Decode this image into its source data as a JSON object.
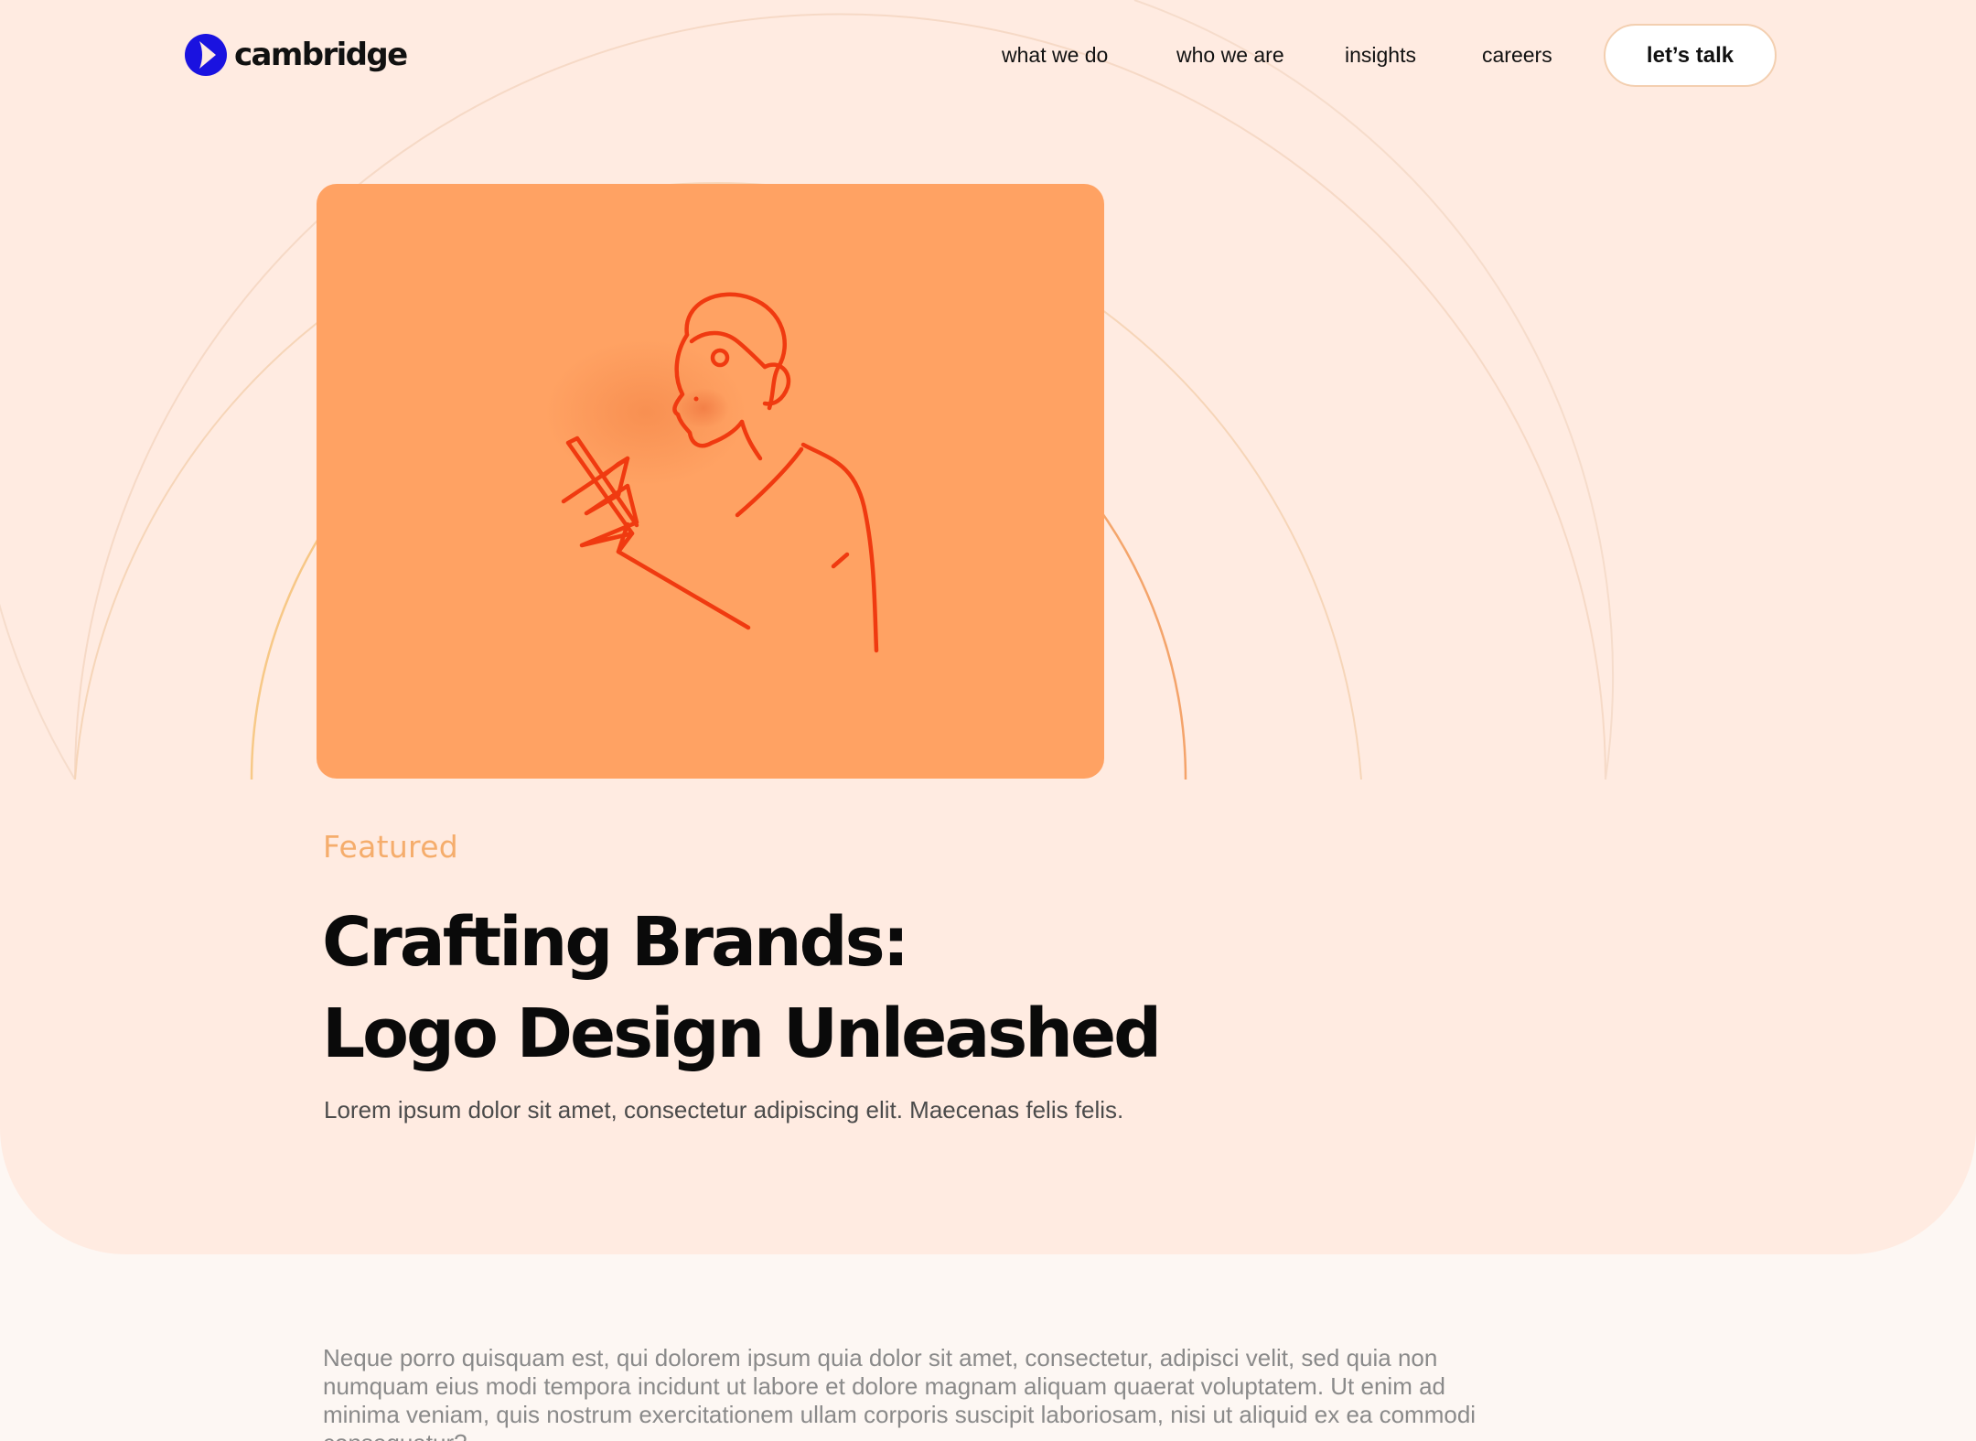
{
  "brand": {
    "name": "cambridge",
    "logo_color": "#1a12e0"
  },
  "nav": {
    "items": [
      {
        "label": "what we do"
      },
      {
        "label": "who we are"
      },
      {
        "label": "insights"
      },
      {
        "label": "careers"
      }
    ],
    "cta_label": "let’s talk"
  },
  "hero": {
    "label": "Featured",
    "title_line1": "Crafting Brands:",
    "title_line2": "Logo Design Unleashed",
    "lede": "Lorem ipsum dolor sit amet, consectetur adipiscing elit. Maecenas felis felis.",
    "image_icon": "person-writing-illustration"
  },
  "article": {
    "body": "Neque porro quisquam est, qui dolorem ipsum quia dolor sit amet, consectetur, adipisci velit, sed quia non numquam eius modi tempora incidunt ut labore et dolore magnam aliquam quaerat voluptatem. Ut enim ad minima veniam, quis nostrum exercitationem ullam corporis suscipit laboriosam, nisi ut aliquid ex ea commodi consequatur?"
  },
  "colors": {
    "hero_bg": "#ffebe1",
    "page_bg": "#fdf7f3",
    "image_bg": "#ffa263",
    "illustration": "#f03a10",
    "featured_label": "#f5ad6c"
  }
}
